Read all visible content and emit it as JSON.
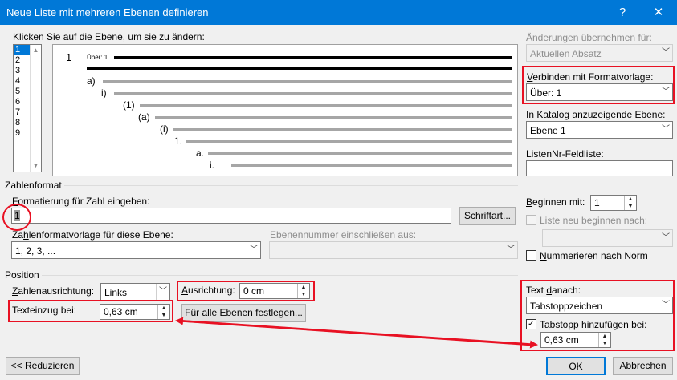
{
  "title": "Neue Liste mit mehreren Ebenen definieren",
  "titlebar_buttons": {
    "help": "?",
    "close": "✕"
  },
  "click_level_label": "Klicken Sie auf die Ebene, um sie zu ändern:",
  "levels": [
    "1",
    "2",
    "3",
    "4",
    "5",
    "6",
    "7",
    "8",
    "9"
  ],
  "preview": {
    "l1": "1",
    "l1_text": "Über: 1",
    "a": "a)",
    "b": "i)",
    "c": "(1)",
    "d": "(a)",
    "e": "(i)",
    "f": "1.",
    "g": "a.",
    "h": "i."
  },
  "apply_changes": {
    "label": "Änderungen übernehmen für:",
    "value": "Aktuellen Absatz"
  },
  "link_style": {
    "label": "Verbinden mit Formatvorlage:",
    "value": "Über: 1"
  },
  "gallery_level": {
    "label": "In Katalog anzuzeigende Ebene:",
    "value": "Ebene 1"
  },
  "listnum": {
    "label": "ListenNr-Feldliste:",
    "value": ""
  },
  "number_format": {
    "section": "Zahlenformat",
    "label": "Formatierung für Zahl eingeben:",
    "value": "1",
    "font_button": "Schriftart...",
    "style_label": "Zahlenformatvorlage für diese Ebene:",
    "style_value": "1, 2, 3, ...",
    "include_label": "Ebenennummer einschließen aus:",
    "include_value": ""
  },
  "start_at": {
    "label": "Beginnen mit:",
    "value": "1"
  },
  "restart": {
    "label": "Liste neu beginnen nach:",
    "value": ""
  },
  "legal": {
    "label": "Nummerieren nach Norm"
  },
  "position": {
    "section": "Position",
    "align_label": "Zahlenausrichtung:",
    "align_value": "Links",
    "at_label": "Ausrichtung:",
    "at_value": "0 cm",
    "indent_label": "Texteinzug bei:",
    "indent_value": "0,63 cm",
    "set_all": "Für alle Ebenen festlegen..."
  },
  "follow": {
    "label": "Text danach:",
    "value": "Tabstoppzeichen",
    "tab_label": "Tabstopp hinzufügen bei:",
    "tab_value": "0,63 cm"
  },
  "buttons": {
    "less": "<< Reduzieren",
    "ok": "OK",
    "cancel": "Abbrechen"
  }
}
